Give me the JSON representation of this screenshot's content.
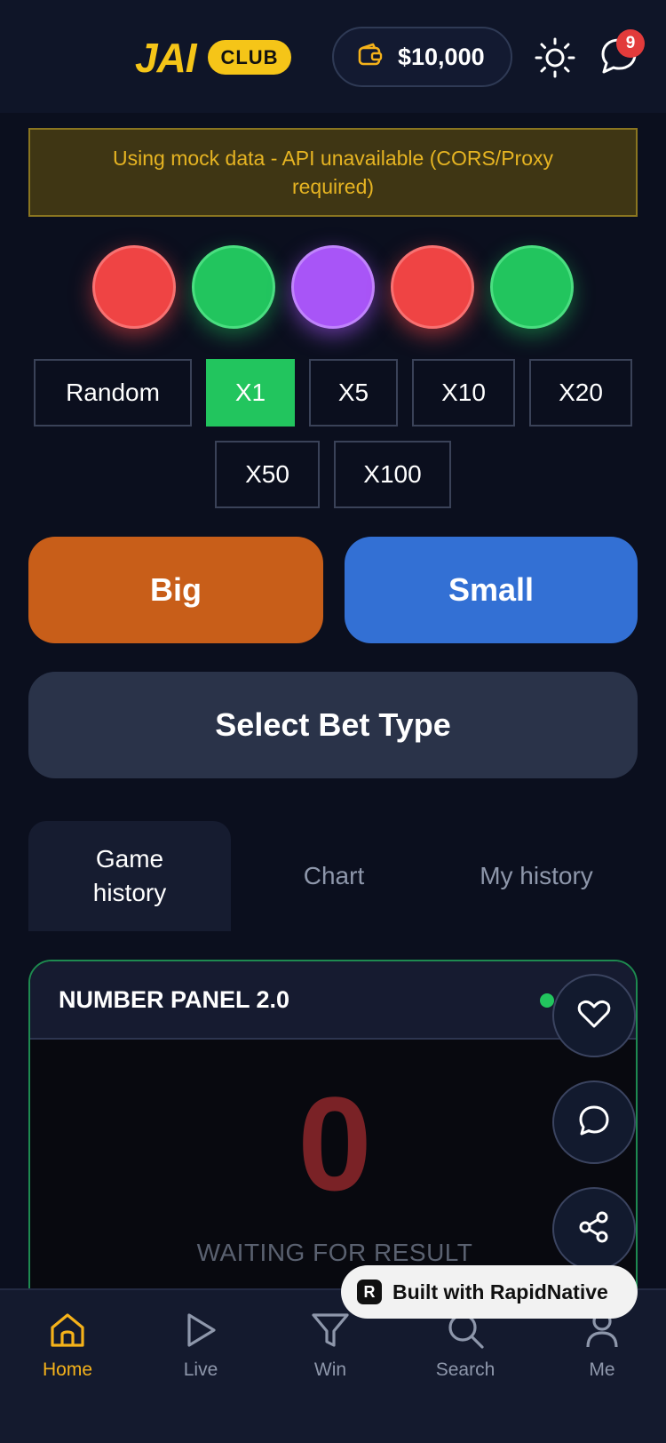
{
  "header": {
    "logo": "JAI",
    "badge": "CLUB",
    "wallet_amount": "$10,000",
    "notification_count": "9"
  },
  "warning": {
    "text": "Using mock data - API unavailable (CORS/Proxy required)"
  },
  "balls": [
    {
      "color": "#ef4444"
    },
    {
      "color": "#22c55e"
    },
    {
      "color": "#a855f7"
    },
    {
      "color": "#ef4444"
    },
    {
      "color": "#22c55e"
    }
  ],
  "multipliers": {
    "random": "Random",
    "x1": "X1",
    "x5": "X5",
    "x10": "X10",
    "x20": "X20",
    "x50": "X50",
    "x100": "X100",
    "selected": "X1"
  },
  "bet": {
    "big_label": "Big",
    "small_label": "Small",
    "select_label": "Select Bet Type"
  },
  "tabs": {
    "game_history": "Game history",
    "chart": "Chart",
    "my_history": "My history"
  },
  "panel": {
    "title": "NUMBER PANEL 2.0",
    "number": "0",
    "status": "WAITING FOR RESULT"
  },
  "builder": {
    "label": "Built with RapidNative"
  },
  "nav": {
    "home": "Home",
    "live": "Live",
    "win": "Win",
    "search": "Search",
    "me": "Me"
  },
  "colors": {
    "accent": "#f5c518",
    "big": "#c85e19",
    "small": "#3370d4",
    "active_multiplier": "#22c55e"
  }
}
